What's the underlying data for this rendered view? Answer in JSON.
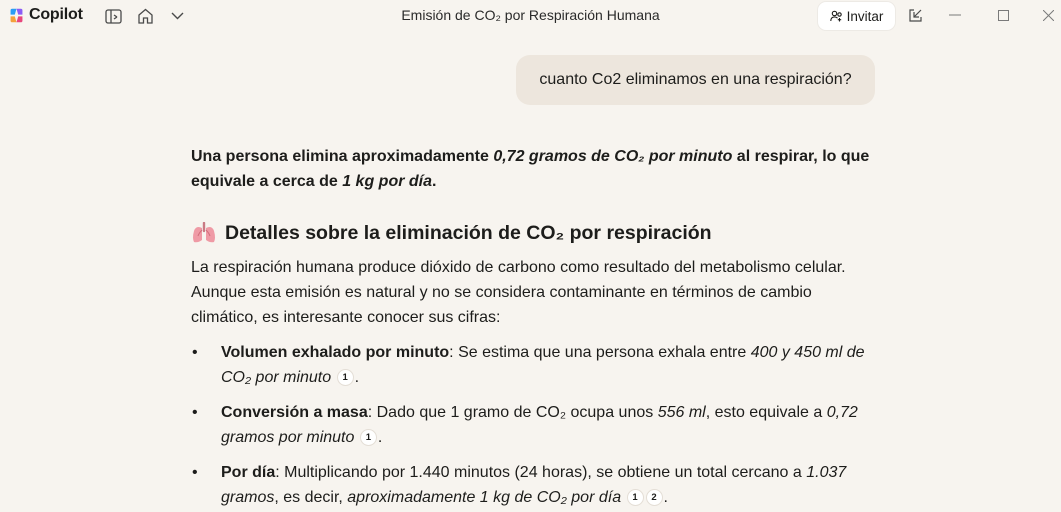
{
  "app": {
    "brand_name": "Copilot",
    "window_title": "Emisión de CO₂ por Respiración Humana",
    "invite_label": "Invitar",
    "accent_colors": {
      "logo": [
        "#f4a13a",
        "#8a5cf6",
        "#2a9df4",
        "#e8467c"
      ]
    }
  },
  "titlebar_icons": [
    "sidebar-toggle-icon",
    "home-icon",
    "chevron-down-icon",
    "popout-icon",
    "minimize-icon",
    "maximize-icon",
    "close-icon"
  ],
  "chat": {
    "user_message": "cuanto Co2 eliminamos en una respiración?",
    "answer": {
      "lead": {
        "p1": "Una persona elimina aproximadamente ",
        "p2": "0,72 gramos de CO₂ por minuto",
        "p3": " al respirar, lo que equivale a cerca de ",
        "p4": "1 kg por día",
        "p5": "."
      },
      "section_icon": "lungs-icon",
      "section_title": "Detalles sobre la eliminación de CO₂ por respiración",
      "intro": "La respiración humana produce dióxido de carbono como resultado del metabolismo celular. Aunque esta emisión es natural y no se considera contaminante en términos de cambio climático, es interesante conocer sus cifras:",
      "bullets": [
        {
          "bold": "Volumen exhalado por minuto",
          "text1": ": Se estima que una persona exhala entre ",
          "italic1": "400 y 450 ml de CO₂ por minuto",
          "text2": "",
          "italic2": "",
          "citations": [
            "1"
          ],
          "end": "."
        },
        {
          "bold": "Conversión a masa",
          "text1": ": Dado que 1 gramo de CO₂ ocupa unos ",
          "italic1": "556 ml",
          "text2": ", esto equivale a ",
          "italic2": "0,72 gramos por minuto",
          "citations": [
            "1"
          ],
          "end": "."
        },
        {
          "bold": "Por día",
          "text1": ": Multiplicando por 1.440 minutos (24 horas), se obtiene un total cercano a ",
          "italic1": "1.037 gramos",
          "text2": ", es decir, ",
          "italic2": "aproximadamente 1 kg de CO₂ por día",
          "citations": [
            "1",
            "2"
          ],
          "end": "."
        }
      ]
    }
  }
}
